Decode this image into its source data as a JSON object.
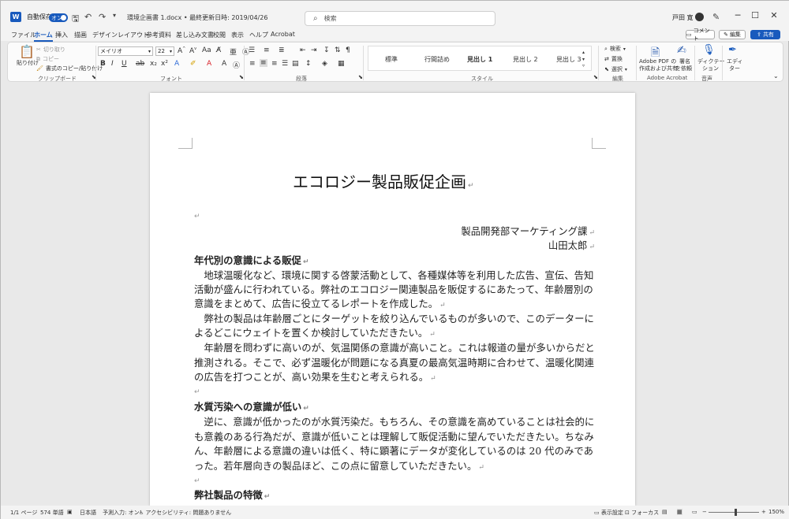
{
  "titlebar": {
    "autosave_label": "自動保存",
    "autosave_state": "オン",
    "doc_title": "環境企画書 1.docx • 最終更新日時: 2019/04/26",
    "search_placeholder": "検索",
    "user_name": "戸田 寛"
  },
  "menu": {
    "tabs": [
      "ファイル",
      "ホーム",
      "挿入",
      "描画",
      "デザイン",
      "レイアウト",
      "参考資料",
      "差し込み文書",
      "校閲",
      "表示",
      "ヘルプ",
      "Acrobat"
    ],
    "active_tab": "ホーム",
    "comment_label": "コメント",
    "edit_label": "編集",
    "share_label": "共有"
  },
  "ribbon": {
    "clipboard": {
      "paste": "貼り付け",
      "cut": "切り取り",
      "copy": "コピー",
      "format_painter": "書式のコピー/貼り付け",
      "group": "クリップボード"
    },
    "font": {
      "name": "メイリオ",
      "size": "22",
      "group": "フォント"
    },
    "paragraph": {
      "group": "段落"
    },
    "styles": {
      "items": [
        "標準",
        "行間詰め",
        "見出し 1",
        "見出し 2",
        "見出し 3"
      ],
      "group": "スタイル"
    },
    "editing": {
      "find": "検索",
      "replace": "置換",
      "select": "選択",
      "group": "編集"
    },
    "acrobat": {
      "create_pdf_line1": "Adobe PDF の",
      "create_pdf_line2": "作成および共有",
      "sign_line1": "署名",
      "sign_line2": "を依頼",
      "group": "Adobe Acrobat"
    },
    "voice": {
      "dictate_line1": "ディクテー",
      "dictate_line2": "ション",
      "group": "音声"
    },
    "editor": {
      "editor_line1": "エディ",
      "editor_line2": "ター"
    }
  },
  "document": {
    "title": "エコロジー製品販促企画",
    "department": "製品開発部マーケティング課",
    "author": "山田太郎",
    "sections": [
      {
        "heading": "年代別の意識による販促",
        "lines": [
          "　地球温暖化など、環境に関する啓蒙活動として、各種媒体等を利用した広告、宣伝、告知",
          "活動が盛んに行われている。弊社のエコロジー関連製品を販促するにあたって、年齢層別の",
          "意識をまとめて、広告に役立てるレポートを作成した。",
          "　弊社の製品は年齢層ごとにターゲットを絞り込んでいるものが多いので、このデーターに",
          "よるどこにウェイトを置くか検討していただきたい。",
          "　年齢層を問わずに高いのが、気温関係の意識が高いこと。これは報道の量が多いからだと",
          "推測される。そこで、必ず温暖化が問題になる真夏の最高気温時期に合わせて、温暖化関連",
          "の広告を打つことが、高い効果を生むと考えられる。"
        ]
      },
      {
        "heading": "水質汚染への意識が低い",
        "lines": [
          "　逆に、意識が低かったのが水質汚染だ。もちろん、その意識を高めていることは社会的に",
          "も意義のある行為だが、意識が低いことは理解して販促活動に望んでいただきたい。ちなみ",
          "ん、年齢層による意識の違いは低く、特に顕著にデータが変化しているのは 20 代のみであ",
          "った。若年層向きの製品ほど、この点に留意していただきたい。"
        ]
      },
      {
        "heading": "弊社製品の特徴",
        "lines": []
      }
    ]
  },
  "statusbar": {
    "page": "1/1 ページ",
    "words": "574 単語",
    "language": "日本語",
    "ime": "予測入力: オン",
    "accessibility": "アクセシビリティ: 問題ありません",
    "display_settings": "表示設定",
    "focus": "フォーカス",
    "zoom": "150%"
  }
}
